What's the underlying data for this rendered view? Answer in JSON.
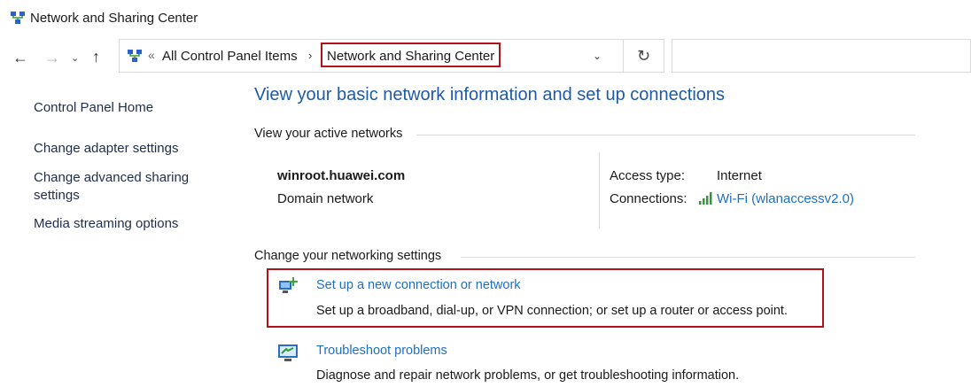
{
  "window": {
    "title": "Network and Sharing Center"
  },
  "nav": {
    "back": "←",
    "forward": "→",
    "recent": "⌄",
    "up": "↑"
  },
  "address": {
    "sep1": "«",
    "crumb1": "All Control Panel Items",
    "sep2": "›",
    "crumb2": "Network and Sharing Center",
    "dropdown": "⌄",
    "refresh": "↻"
  },
  "search": {
    "value": ""
  },
  "sidebar": {
    "items": [
      {
        "label": "Control Panel Home"
      },
      {
        "label": "Change adapter settings"
      },
      {
        "label": "Change advanced sharing settings"
      },
      {
        "label": "Media streaming options"
      }
    ]
  },
  "main": {
    "heading": "View your basic network information and set up connections",
    "active_section": "View your active networks",
    "network": {
      "name": "winroot.huawei.com",
      "type": "Domain network",
      "access_label": "Access type:",
      "access_value": "Internet",
      "connections_label": "Connections:",
      "connection_link": "Wi-Fi (wlanaccessv2.0)"
    },
    "change_section": "Change your networking settings",
    "tasks": [
      {
        "link": "Set up a new connection or network",
        "desc": "Set up a broadband, dial-up, or VPN connection; or set up a router or access point.",
        "icon": "new-connection-icon"
      },
      {
        "link": "Troubleshoot problems",
        "desc": "Diagnose and repair network problems, or get troubleshooting information.",
        "icon": "troubleshoot-icon"
      }
    ]
  },
  "colors": {
    "accent": "#1e6fc6",
    "heading": "#1e5aa8",
    "highlight": "#b2121c"
  }
}
